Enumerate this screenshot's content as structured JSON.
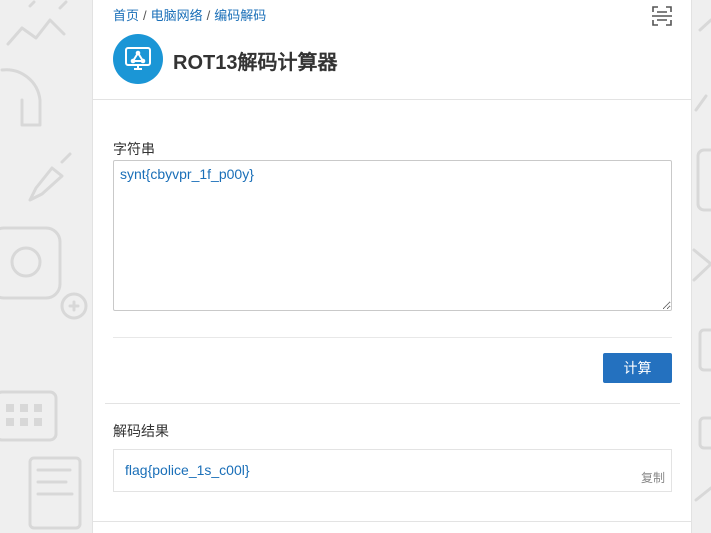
{
  "breadcrumb": {
    "items": [
      {
        "label": "首页"
      },
      {
        "label": "电脑网络"
      },
      {
        "label": "编码解码"
      }
    ],
    "separator": "/"
  },
  "header": {
    "title": "ROT13解码计算器",
    "logo_icon": "share-nodes-monitor-icon",
    "scan_icon": "scan-icon"
  },
  "form": {
    "input_label": "字符串",
    "input_value": "synt{cbyvpr_1f_p00y}",
    "calculate_label": "计算"
  },
  "result": {
    "label": "解码结果",
    "value": "flag{police_1s_c00l}",
    "copy_label": "复制"
  },
  "colors": {
    "link": "#1a6fb8",
    "logo_bg": "#1b96d6",
    "button_bg": "#2471bf",
    "page_bg": "#efefef"
  }
}
